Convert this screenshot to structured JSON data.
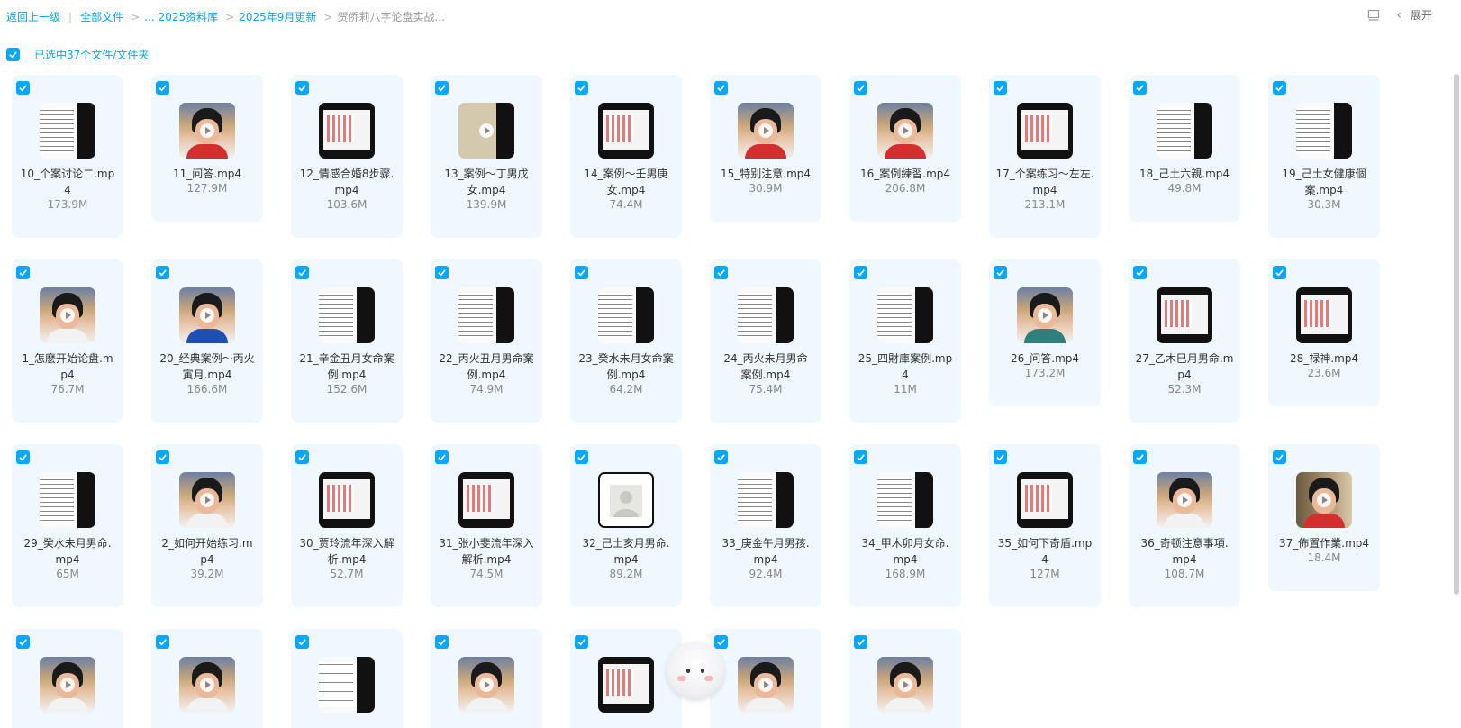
{
  "breadcrumb": {
    "back": "返回上一级",
    "all_files": "全部文件",
    "ellipsis": "...",
    "lib": "2025资料库",
    "month": "2025年9月更新",
    "current": "贺侨莉八字论盘实战..."
  },
  "toolbar": {
    "expand": "展开"
  },
  "selection": {
    "text": "已选中37个文件/文件夹"
  },
  "colors": {
    "accent": "#06a7ff",
    "tile_bg": "#eef8fe"
  },
  "files": [
    {
      "line1": "10_个案讨论二.mp",
      "line2": "4",
      "size": "173.9M",
      "thumb": "doc"
    },
    {
      "line1": "11_问答.mp4",
      "line2": "",
      "size": "127.9M",
      "thumb": "face-red"
    },
    {
      "line1": "12_情感合婚8步骤.",
      "line2": "mp4",
      "size": "103.6M",
      "thumb": "screen"
    },
    {
      "line1": "13_案例～丁男戊",
      "line2": "女.mp4",
      "size": "139.9M",
      "thumb": "paper"
    },
    {
      "line1": "14_案例～壬男庚",
      "line2": "女.mp4",
      "size": "74.4M",
      "thumb": "screen"
    },
    {
      "line1": "15_特别注意.mp4",
      "line2": "",
      "size": "30.9M",
      "thumb": "face-red"
    },
    {
      "line1": "16_案例練習.mp4",
      "line2": "",
      "size": "206.8M",
      "thumb": "face-red"
    },
    {
      "line1": "17_个案练习～左左.",
      "line2": "mp4",
      "size": "213.1M",
      "thumb": "screen"
    },
    {
      "line1": "18_己土六親.mp4",
      "line2": "",
      "size": "49.8M",
      "thumb": "doc"
    },
    {
      "line1": "19_己土女健康個",
      "line2": "案.mp4",
      "size": "30.3M",
      "thumb": "doc"
    },
    {
      "line1": "1_怎麽开始论盘.m",
      "line2": "p4",
      "size": "76.7M",
      "thumb": "face-white"
    },
    {
      "line1": "20_经典案例～丙火",
      "line2": "寅月.mp4",
      "size": "166.6M",
      "thumb": "face-blue"
    },
    {
      "line1": "21_辛金丑月女命案",
      "line2": "例.mp4",
      "size": "152.6M",
      "thumb": "doc"
    },
    {
      "line1": "22_丙火丑月男命案",
      "line2": "例.mp4",
      "size": "74.9M",
      "thumb": "doc"
    },
    {
      "line1": "23_癸水未月女命案",
      "line2": "例.mp4",
      "size": "64.2M",
      "thumb": "doc"
    },
    {
      "line1": "24_丙火未月男命",
      "line2": "案例.mp4",
      "size": "75.4M",
      "thumb": "doc"
    },
    {
      "line1": "25_四財庫案例.mp",
      "line2": "4",
      "size": "11M",
      "thumb": "doc"
    },
    {
      "line1": "26_问答.mp4",
      "line2": "",
      "size": "173.2M",
      "thumb": "face-teal"
    },
    {
      "line1": "27_乙木巳月男命.m",
      "line2": "p4",
      "size": "52.3M",
      "thumb": "screen"
    },
    {
      "line1": "28_禄神.mp4",
      "line2": "",
      "size": "23.6M",
      "thumb": "screen"
    },
    {
      "line1": "29_癸水未月男命.",
      "line2": "mp4",
      "size": "65M",
      "thumb": "doc"
    },
    {
      "line1": "2_如何开始练习.m",
      "line2": "p4",
      "size": "39.2M",
      "thumb": "face-white"
    },
    {
      "line1": "30_贾玲流年深入解",
      "line2": "析.mp4",
      "size": "52.7M",
      "thumb": "screen"
    },
    {
      "line1": "31_张小斐流年深入",
      "line2": "解析.mp4",
      "size": "74.5M",
      "thumb": "screen"
    },
    {
      "line1": "32_己土亥月男命.",
      "line2": "mp4",
      "size": "89.2M",
      "thumb": "placeholder"
    },
    {
      "line1": "33_庚金午月男孩.",
      "line2": "mp4",
      "size": "92.4M",
      "thumb": "doc"
    },
    {
      "line1": "34_甲木卯月女命.",
      "line2": "mp4",
      "size": "168.9M",
      "thumb": "doc"
    },
    {
      "line1": "35_如何下奇盾.mp",
      "line2": "4",
      "size": "127M",
      "thumb": "screen"
    },
    {
      "line1": "36_奇顿注意事項.",
      "line2": "mp4",
      "size": "108.7M",
      "thumb": "face-white"
    },
    {
      "line1": "37_佈置作業.mp4",
      "line2": "",
      "size": "18.4M",
      "thumb": "face-book"
    },
    {
      "line1": "",
      "line2": "",
      "size": "",
      "thumb": "face-white"
    },
    {
      "line1": "",
      "line2": "",
      "size": "",
      "thumb": "face-white"
    },
    {
      "line1": "",
      "line2": "",
      "size": "",
      "thumb": "doc"
    },
    {
      "line1": "",
      "line2": "",
      "size": "",
      "thumb": "face-white"
    },
    {
      "line1": "",
      "line2": "",
      "size": "",
      "thumb": "screen"
    },
    {
      "line1": "",
      "line2": "",
      "size": "",
      "thumb": "face-white"
    },
    {
      "line1": "",
      "line2": "",
      "size": "",
      "thumb": "face-white"
    }
  ]
}
